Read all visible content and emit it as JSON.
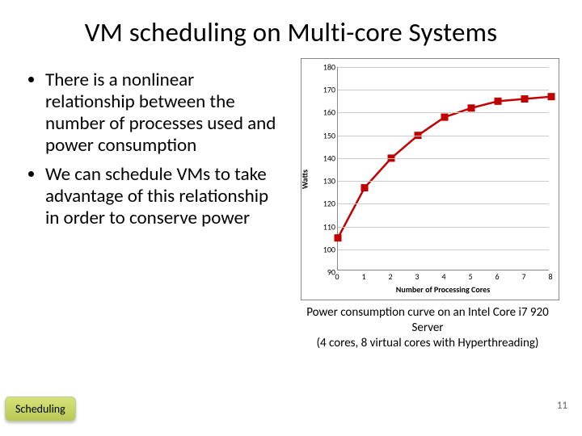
{
  "title": "VM scheduling on Multi-core Systems",
  "bullets": [
    "There is a nonlinear relationship between the number of processes used and power consumption",
    "We can schedule VMs to take advantage of this relationship in order to conserve power"
  ],
  "chart_data": {
    "type": "line",
    "x": [
      0,
      1,
      2,
      3,
      4,
      5,
      6,
      7,
      8
    ],
    "values": [
      105,
      127,
      140,
      150,
      158,
      162,
      165,
      166,
      167
    ],
    "xlabel": "Number of Processing Cores",
    "ylabel": "Watts",
    "ylim": [
      90,
      180
    ],
    "xlim": [
      0,
      8
    ],
    "y_ticks": [
      90,
      100,
      110,
      120,
      130,
      140,
      150,
      160,
      170,
      180
    ],
    "x_ticks": [
      0,
      1,
      2,
      3,
      4,
      5,
      6,
      7,
      8
    ]
  },
  "caption": "Power consumption curve on an Intel Core i7 920 Server\n(4 cores, 8 virtual cores with Hyperthreading)",
  "badge": "Scheduling",
  "page_number": "11"
}
